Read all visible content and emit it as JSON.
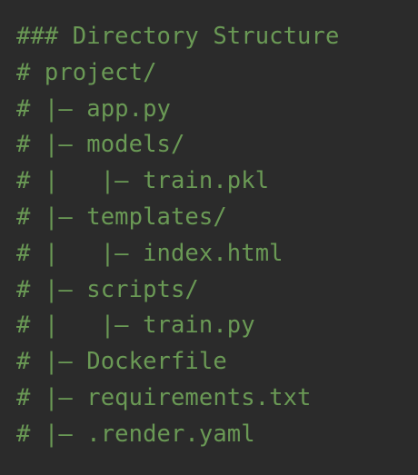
{
  "editor": {
    "text_color": "#6a9955",
    "background": "#2b2b2b",
    "lines": [
      "### Directory Structure",
      "# project/",
      "# |— app.py",
      "# |— models/",
      "# |   |— train.pkl",
      "# |— templates/",
      "# |   |— index.html",
      "# |— scripts/",
      "# |   |— train.py",
      "# |— Dockerfile",
      "# |— requirements.txt",
      "# |— .render.yaml"
    ]
  }
}
